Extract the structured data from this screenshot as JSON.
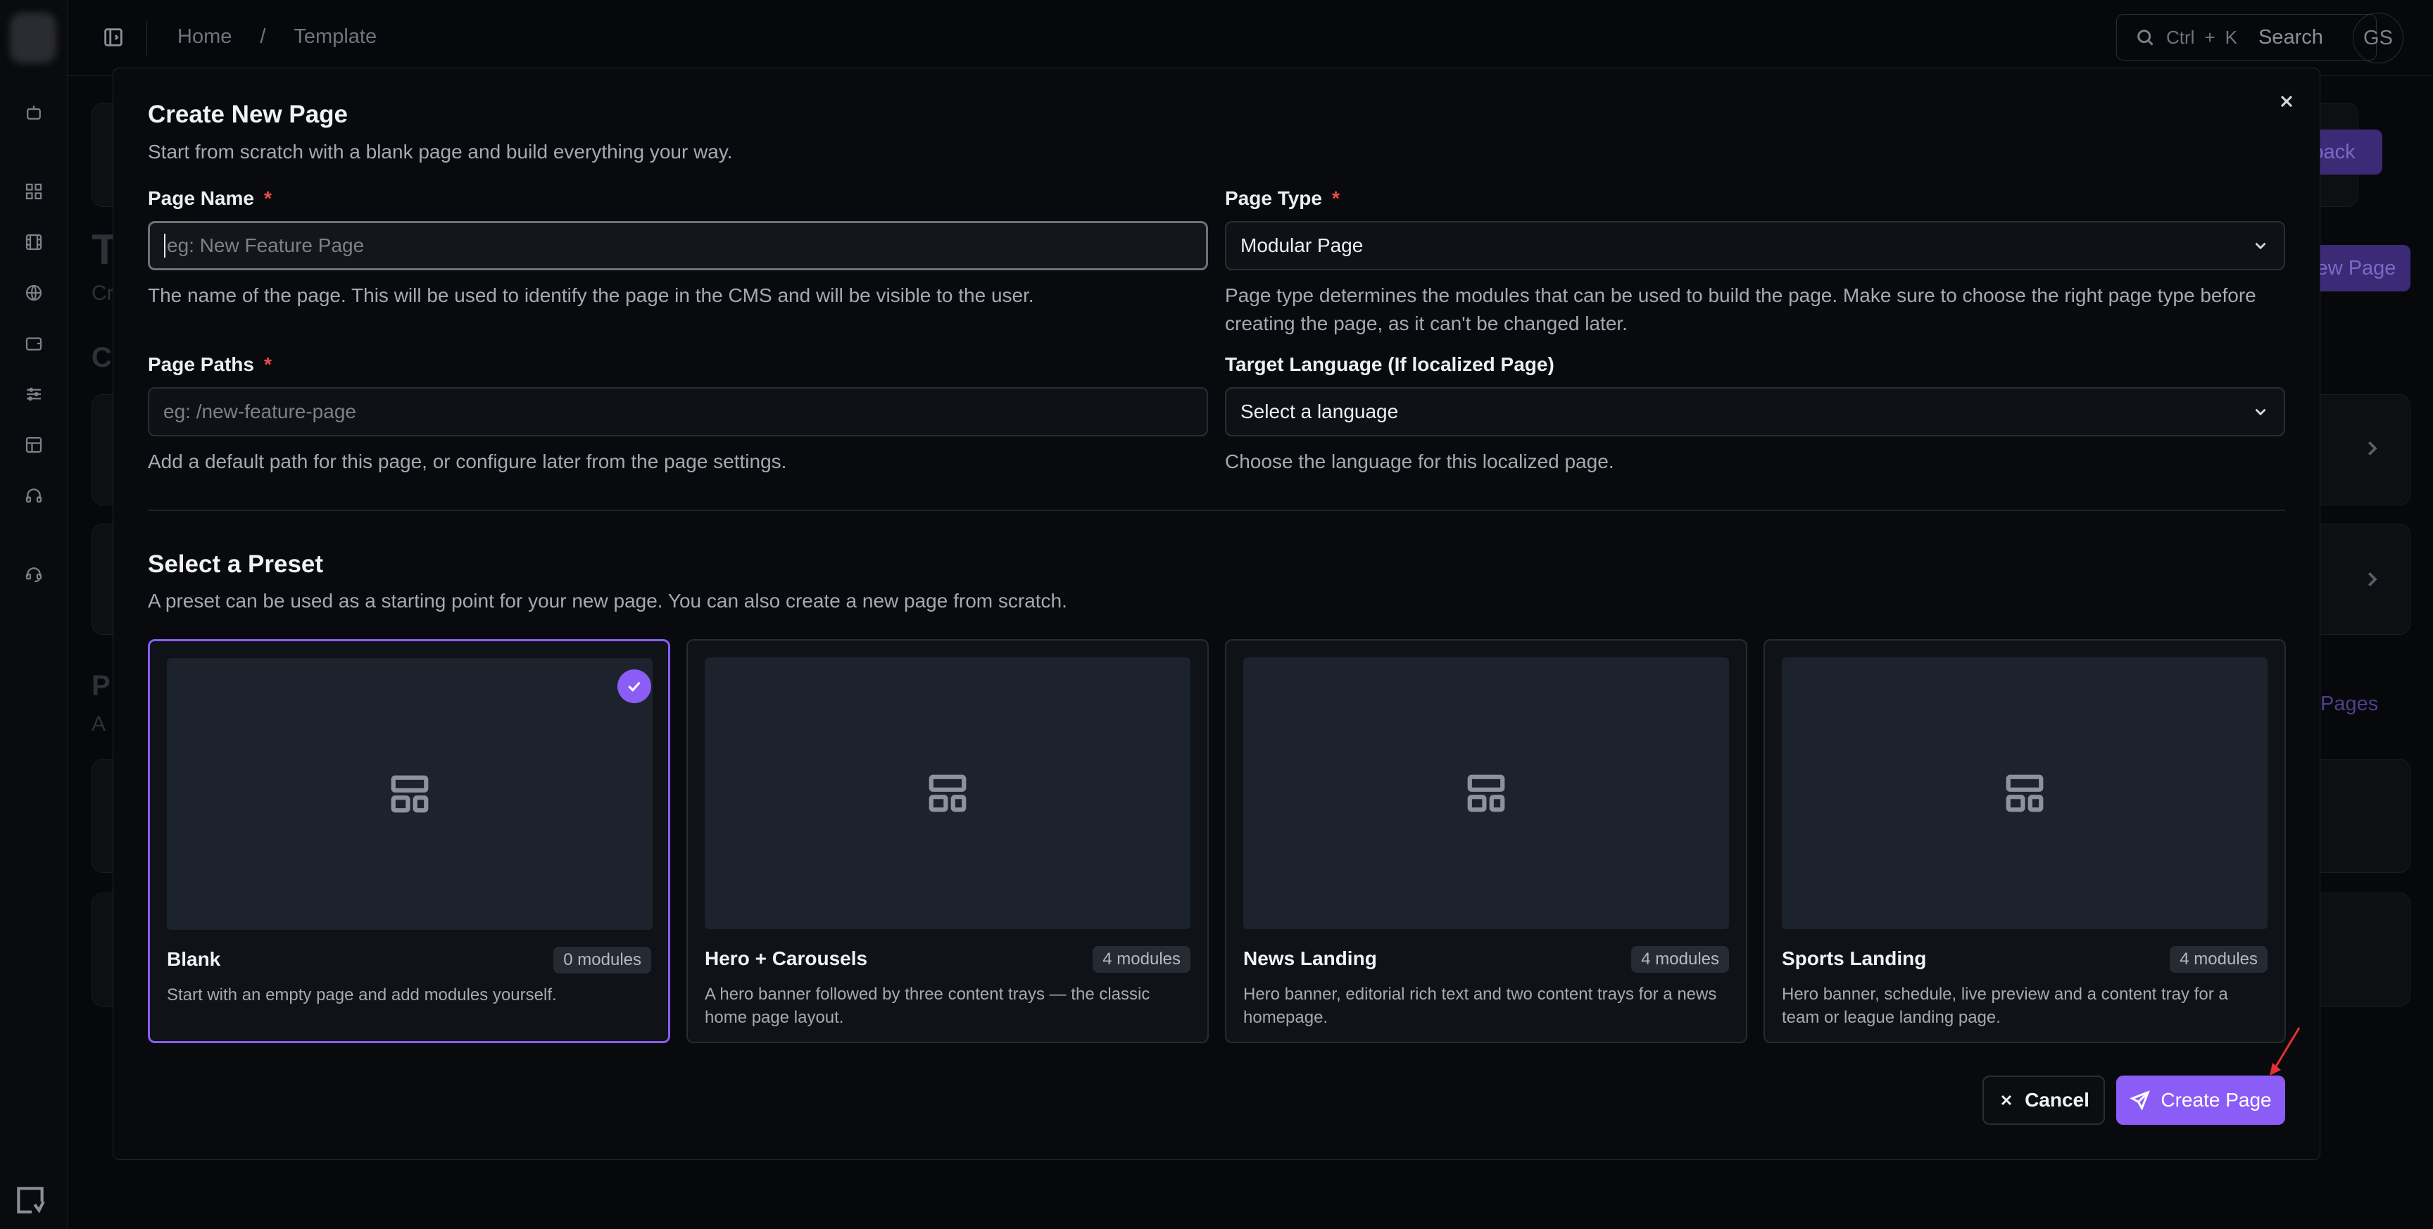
{
  "topbar": {
    "breadcrumb_home": "Home",
    "breadcrumb_sep": "/",
    "breadcrumb_current": "Template",
    "search_shortcut_ctrl": "Ctrl",
    "search_shortcut_plus": "+",
    "search_shortcut_k": "K",
    "search_label": "Search",
    "avatar_initials": "GS"
  },
  "background": {
    "feedback_btn": "dback",
    "new_page_btn": "ew Page",
    "pages_link": "Pages",
    "partial_title": "T",
    "partial_sub": "Cr",
    "partial_section_c": "C",
    "partial_section_p": "P",
    "partial_section_a": "A"
  },
  "modal": {
    "title": "Create New Page",
    "subtitle": "Start from scratch with a blank page and build everything your way.",
    "page_name": {
      "label": "Page Name",
      "required": "*",
      "placeholder": "eg: New Feature Page",
      "help": "The name of the page. This will be used to identify the page in the CMS and will be visible to the user."
    },
    "page_type": {
      "label": "Page Type",
      "required": "*",
      "value": "Modular Page",
      "help": "Page type determines the modules that can be used to build the page. Make sure to choose the right page type before creating the page, as it can't be changed later."
    },
    "page_paths": {
      "label": "Page Paths",
      "required": "*",
      "placeholder": "eg: /new-feature-page",
      "help": "Add a default path for this page, or configure later from the page settings."
    },
    "target_language": {
      "label": "Target Language (If localized Page)",
      "value": "Select a language",
      "help": "Choose the language for this localized page."
    },
    "preset_title": "Select a Preset",
    "preset_subtitle": "A preset can be used as a starting point for your new page. You can also create a new page from scratch.",
    "presets": [
      {
        "name": "Blank",
        "modules": "0 modules",
        "description": "Start with an empty page and add modules yourself.",
        "selected": true
      },
      {
        "name": "Hero + Carousels",
        "modules": "4 modules",
        "description": "A hero banner followed by three content trays — the classic home page layout.",
        "selected": false
      },
      {
        "name": "News Landing",
        "modules": "4 modules",
        "description": "Hero banner, editorial rich text and two content trays for a news homepage.",
        "selected": false
      },
      {
        "name": "Sports Landing",
        "modules": "4 modules",
        "description": "Hero banner, schedule, live preview and a content tray for a team or league landing page.",
        "selected": false
      }
    ],
    "cancel_label": "Cancel",
    "create_label": "Create Page"
  },
  "colors": {
    "accent": "#8b5cf6",
    "required": "#ef4a4a",
    "background": "#07080b",
    "modal_bg": "#090a0e"
  },
  "icons": {
    "close": "close-icon",
    "chevron": "chevron-down-icon",
    "layout": "layout-template-icon",
    "check": "check-icon",
    "send": "send-icon",
    "search": "search-icon"
  }
}
